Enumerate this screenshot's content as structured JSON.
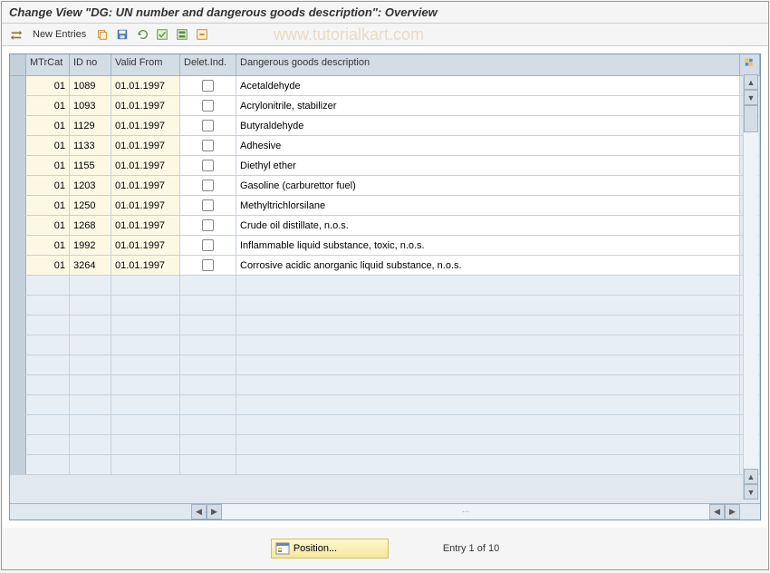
{
  "header": {
    "title": "Change View \"DG: UN number and dangerous goods description\": Overview"
  },
  "toolbar": {
    "new_entries_label": "New Entries"
  },
  "watermark": "www.tutorialkart.com",
  "table": {
    "columns": {
      "mtrcat": "MTrCat",
      "idno": "ID no",
      "valid_from": "Valid From",
      "delind": "Delet.Ind.",
      "desc": "Dangerous goods description"
    },
    "rows": [
      {
        "mtrcat": "01",
        "idno": "1089",
        "valid": "01.01.1997",
        "desc": "Acetaldehyde"
      },
      {
        "mtrcat": "01",
        "idno": "1093",
        "valid": "01.01.1997",
        "desc": "Acrylonitrile, stabilizer"
      },
      {
        "mtrcat": "01",
        "idno": "1129",
        "valid": "01.01.1997",
        "desc": "Butyraldehyde"
      },
      {
        "mtrcat": "01",
        "idno": "1133",
        "valid": "01.01.1997",
        "desc": "Adhesive"
      },
      {
        "mtrcat": "01",
        "idno": "1155",
        "valid": "01.01.1997",
        "desc": "Diethyl ether"
      },
      {
        "mtrcat": "01",
        "idno": "1203",
        "valid": "01.01.1997",
        "desc": "Gasoline (carburettor fuel)"
      },
      {
        "mtrcat": "01",
        "idno": "1250",
        "valid": "01.01.1997",
        "desc": "Methyltrichlorsilane"
      },
      {
        "mtrcat": "01",
        "idno": "1268",
        "valid": "01.01.1997",
        "desc": "Crude oil distillate, n.o.s."
      },
      {
        "mtrcat": "01",
        "idno": "1992",
        "valid": "01.01.1997",
        "desc": "Inflammable liquid substance, toxic, n.o.s."
      },
      {
        "mtrcat": "01",
        "idno": "3264",
        "valid": "01.01.1997",
        "desc": "Corrosive acidic anorganic liquid substance, n.o.s."
      }
    ],
    "empty_rows": 10
  },
  "footer": {
    "position_label": "Position...",
    "entry_text": "Entry 1 of 10"
  }
}
